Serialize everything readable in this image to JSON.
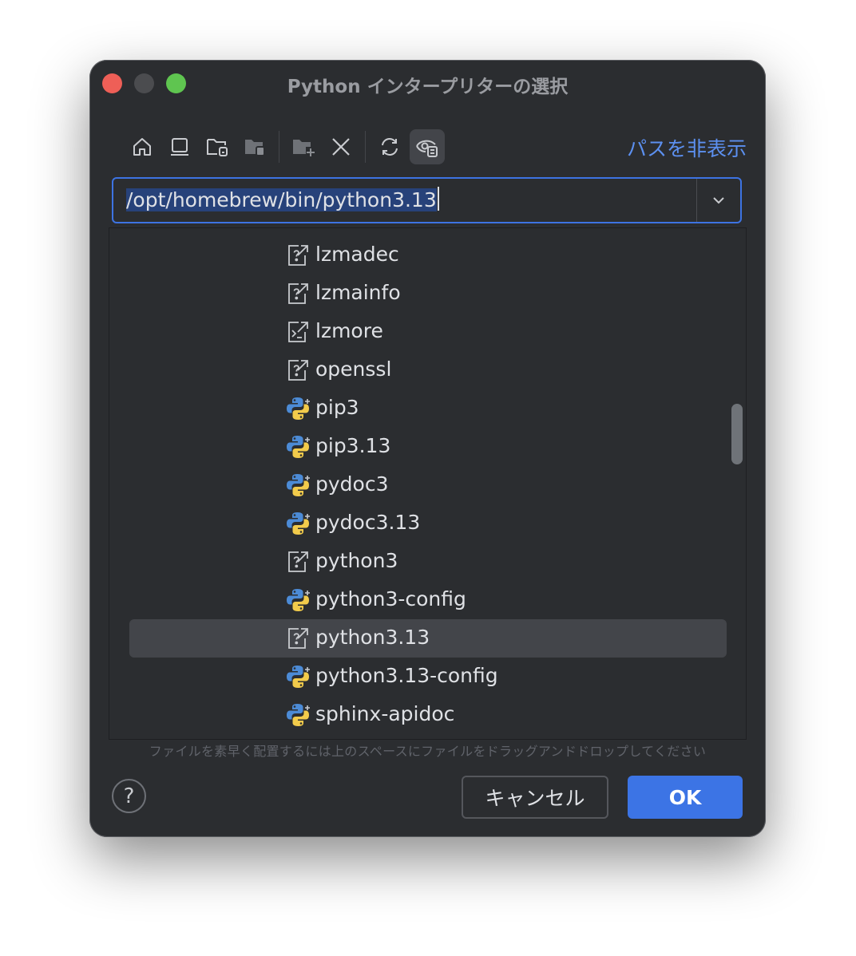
{
  "window": {
    "title": "Python インタープリターの選択"
  },
  "toolbar": {
    "buttons": [
      {
        "name": "home-icon"
      },
      {
        "name": "desktop-icon"
      },
      {
        "name": "project-folder-icon"
      },
      {
        "name": "module-folder-icon"
      },
      {
        "name": "new-folder-icon"
      },
      {
        "name": "delete-icon"
      },
      {
        "name": "refresh-icon"
      },
      {
        "name": "show-hidden-icon"
      }
    ],
    "hide_path_label": "パスを非表示"
  },
  "path": {
    "value": "/opt/homebrew/bin/python3.13"
  },
  "tree": {
    "items": [
      {
        "label": "lzmadec",
        "icon": "link-icon"
      },
      {
        "label": "lzmainfo",
        "icon": "link-icon"
      },
      {
        "label": "lzmore",
        "icon": "terminal-icon"
      },
      {
        "label": "openssl",
        "icon": "link-icon"
      },
      {
        "label": "pip3",
        "icon": "python-icon"
      },
      {
        "label": "pip3.13",
        "icon": "python-icon"
      },
      {
        "label": "pydoc3",
        "icon": "python-icon"
      },
      {
        "label": "pydoc3.13",
        "icon": "python-icon"
      },
      {
        "label": "python3",
        "icon": "link-icon"
      },
      {
        "label": "python3-config",
        "icon": "python-icon"
      },
      {
        "label": "python3.13",
        "icon": "link-icon",
        "selected": true
      },
      {
        "label": "python3.13-config",
        "icon": "python-icon"
      },
      {
        "label": "sphinx-apidoc",
        "icon": "python-icon"
      }
    ]
  },
  "hint": "ファイルを素早く配置するには上のスペースにファイルをドラッグアンドドロップしてください",
  "buttons": {
    "help": "?",
    "cancel": "キャンセル",
    "ok": "OK"
  },
  "colors": {
    "accent": "#3c74e5",
    "link": "#5c90f0",
    "background": "#2b2d30",
    "selection": "#43454a"
  }
}
